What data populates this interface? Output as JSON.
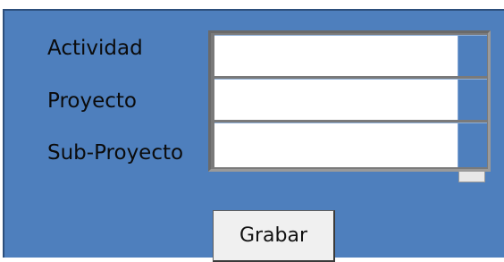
{
  "form": {
    "fields": {
      "actividad": {
        "label": "Actividad",
        "value": ""
      },
      "proyecto": {
        "label": "Proyecto",
        "value": ""
      },
      "subproyecto": {
        "label": "Sub-Proyecto",
        "value": ""
      }
    },
    "save_button_label": "Grabar"
  },
  "colors": {
    "panel_background": "#4e7fbd",
    "list_background": "#ffffff",
    "button_background": "#f0f0f0"
  }
}
